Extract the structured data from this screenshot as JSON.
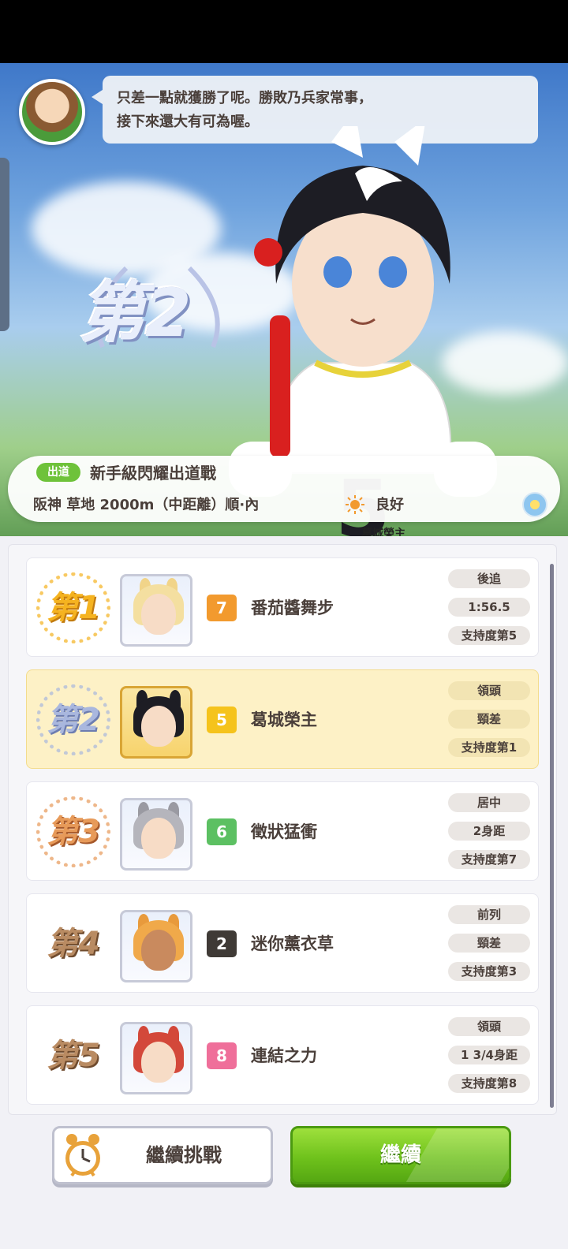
{
  "dialogue": {
    "line1": "只差一點就獲勝了呢。勝敗乃兵家常事，",
    "line2": "接下來還大有可為喔。"
  },
  "result": {
    "place": "第2",
    "bib_number": "5",
    "apron_name": "葛城榮主"
  },
  "race": {
    "grade": "出道",
    "name": "新手級閃耀出道戰",
    "course": "阪神 草地 2000m（中距離）順·內",
    "weather": "良好"
  },
  "results": [
    {
      "rank": "第1",
      "gate": "7",
      "gate_color": "#f29a2e",
      "name": "番茄醬舞步",
      "style": "後追",
      "margin": "1:56.5",
      "popularity": "支持度第5",
      "highlight": false
    },
    {
      "rank": "第2",
      "gate": "5",
      "gate_color": "#f5c31c",
      "name": "葛城榮主",
      "style": "領頭",
      "margin": "頸差",
      "popularity": "支持度第1",
      "highlight": true
    },
    {
      "rank": "第3",
      "gate": "6",
      "gate_color": "#5cc062",
      "name": "徵狀猛衝",
      "style": "居中",
      "margin": "2身距",
      "popularity": "支持度第7",
      "highlight": false
    },
    {
      "rank": "第4",
      "gate": "2",
      "gate_color": "#3f3a36",
      "name": "迷你薰衣草",
      "style": "前列",
      "margin": "頸差",
      "popularity": "支持度第3",
      "highlight": false
    },
    {
      "rank": "第5",
      "gate": "8",
      "gate_color": "#ef6f9a",
      "name": "連結之力",
      "style": "領頭",
      "margin": "1 3/4身距",
      "popularity": "支持度第8",
      "highlight": false
    }
  ],
  "buttons": {
    "retry": "繼續挑戰",
    "continue": "繼續"
  }
}
